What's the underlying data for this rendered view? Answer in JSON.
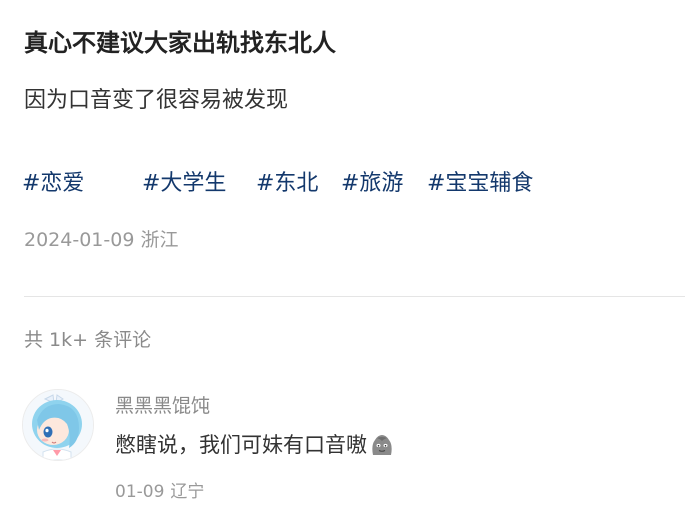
{
  "post": {
    "title": "真心不建议大家出轨找东北人",
    "body": "因为口音变了很容易被发现",
    "tags": [
      "#恋爱",
      "#大学生",
      "#东北",
      "#旅游",
      "#宝宝辅食"
    ],
    "date": "2024-01-09",
    "location": "浙江"
  },
  "comments": {
    "count_label": "共 1k+ 条评论",
    "items": [
      {
        "author": "黑黑黑馄饨",
        "text": "憋瞎说，我们可妹有口音嗷",
        "emoji": "dull-face-emoji",
        "date": "01-09",
        "location": "辽宁"
      }
    ]
  }
}
